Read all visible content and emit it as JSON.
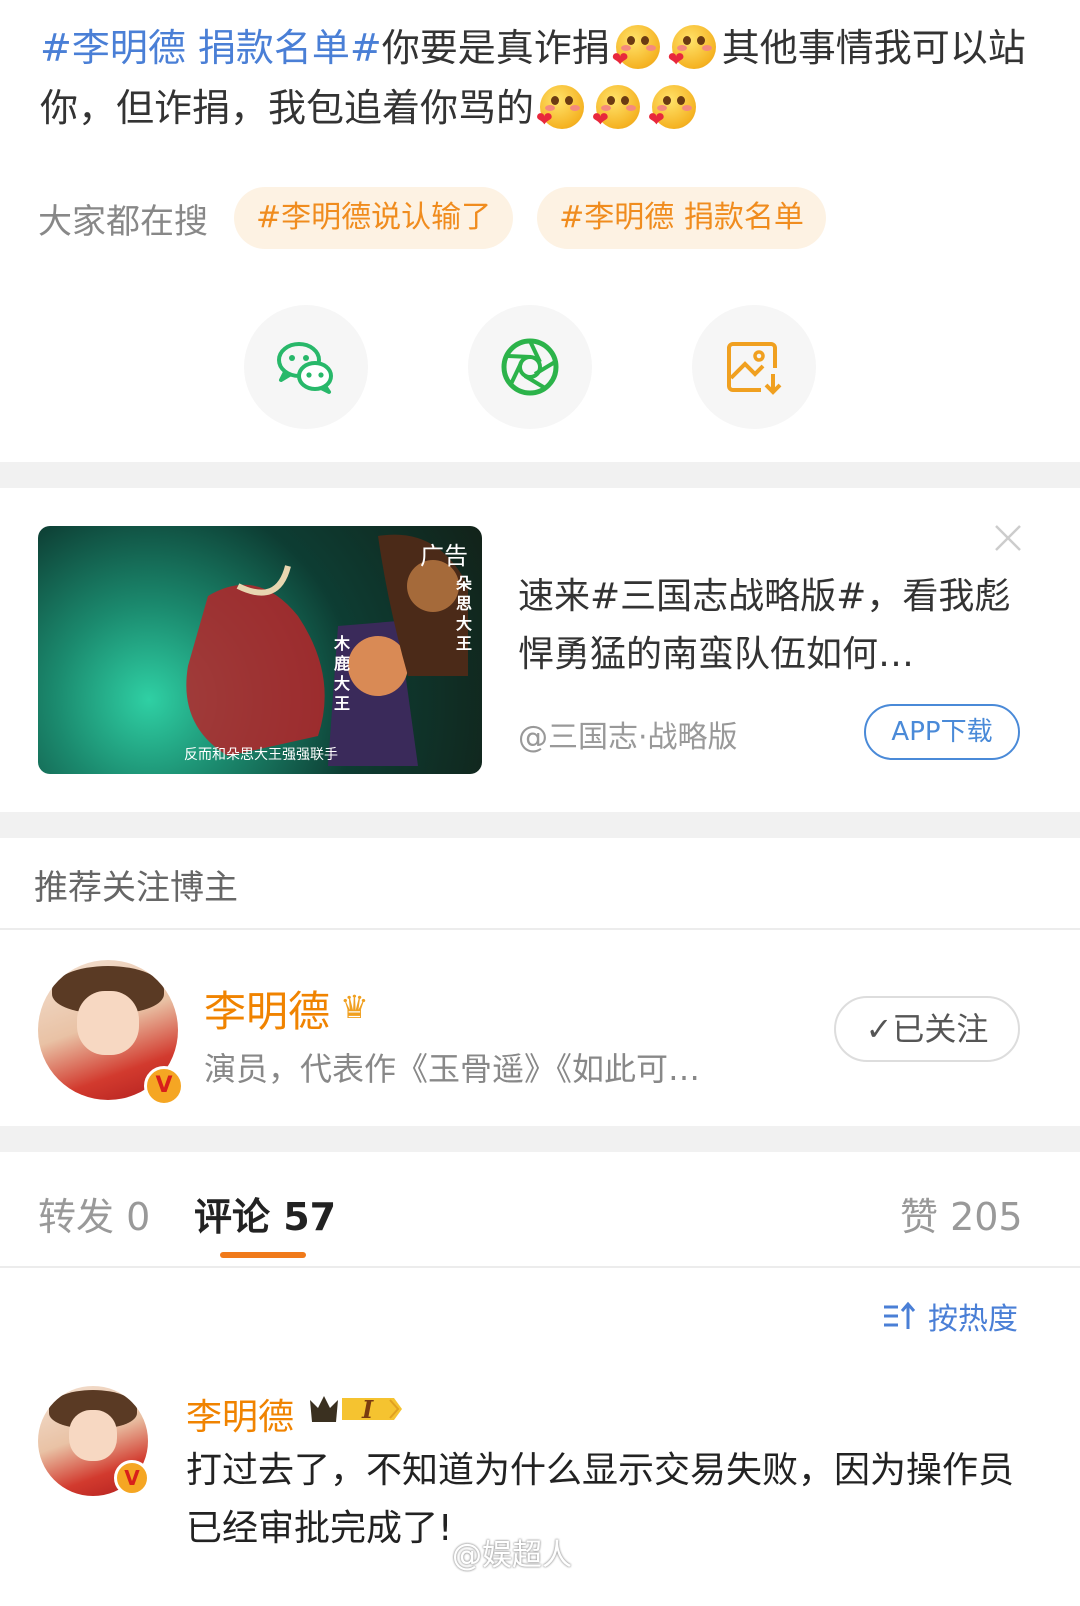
{
  "post": {
    "tag1": "#李明德 捐款名单#",
    "text1": "你要是真诈捐",
    "text2": "其他事情我可以站你，但诈捐，我包追着你骂的",
    "emoji_icon": "blush-heart-emoji-icon"
  },
  "search": {
    "label": "大家都在搜",
    "chips": [
      "#李明德说认输了",
      "#李明德 捐款名单"
    ]
  },
  "share": {
    "icons": [
      "wechat-icon",
      "moments-icon",
      "save-image-icon"
    ],
    "colors": {
      "wechat": "#28b86a",
      "moments": "#2cb34a",
      "save": "#f0a020"
    }
  },
  "ad": {
    "badge": "广告",
    "caption": "反而和朵思大王强强联手",
    "image_labels": [
      "朵思大王",
      "木鹿大王"
    ],
    "title": "速来#三国志战略版#，看我彪悍勇猛的南蛮队伍如何…",
    "source": "@三国志·战略版",
    "download_label": "APP下载"
  },
  "recommend": {
    "header": "推荐关注博主",
    "name": "李明德",
    "description": "演员，代表作《玉骨遥》《如此可…",
    "follow_label": "✓已关注",
    "verified_badge": "V"
  },
  "tabs": {
    "repost": "转发 0",
    "comments": "评论 57",
    "likes": "赞 205"
  },
  "sort": {
    "label": "按热度"
  },
  "comment": {
    "name": "李明德",
    "level_badge": "I",
    "text": "打过去了，不知道为什么显示交易失败，因为操作员已经审批完成了!",
    "verified_badge": "V"
  },
  "watermark": "@娱超人",
  "colors": {
    "accent_orange": "#f08300",
    "link_blue": "#4a7fd6",
    "chip_bg": "#fdf2e3"
  }
}
